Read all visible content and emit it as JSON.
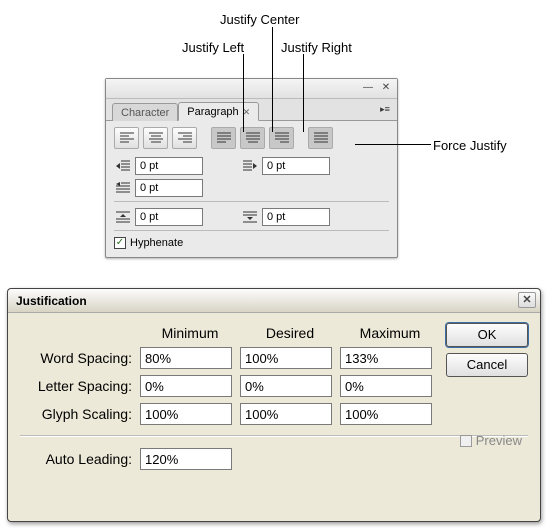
{
  "callouts": {
    "justify_left": "Justify Left",
    "justify_center": "Justify Center",
    "justify_right": "Justify Right",
    "force_justify": "Force Justify"
  },
  "panel": {
    "tabs": {
      "character": "Character",
      "paragraph": "Paragraph"
    },
    "inputs": {
      "indent_left": "0 pt",
      "indent_right": "0 pt",
      "first_line": "0 pt",
      "space_before": "0 pt",
      "space_after": "0 pt"
    },
    "hyphenate_label": "Hyphenate"
  },
  "dialog": {
    "title": "Justification",
    "headers": {
      "min": "Minimum",
      "desired": "Desired",
      "max": "Maximum"
    },
    "labels": {
      "word": "Word Spacing:",
      "letter": "Letter Spacing:",
      "glyph": "Glyph Scaling:",
      "leading": "Auto Leading:"
    },
    "word": {
      "min": "80%",
      "desired": "100%",
      "max": "133%"
    },
    "letter": {
      "min": "0%",
      "desired": "0%",
      "max": "0%"
    },
    "glyph": {
      "min": "100%",
      "desired": "100%",
      "max": "100%"
    },
    "leading": "120%",
    "buttons": {
      "ok": "OK",
      "cancel": "Cancel",
      "preview": "Preview"
    }
  }
}
